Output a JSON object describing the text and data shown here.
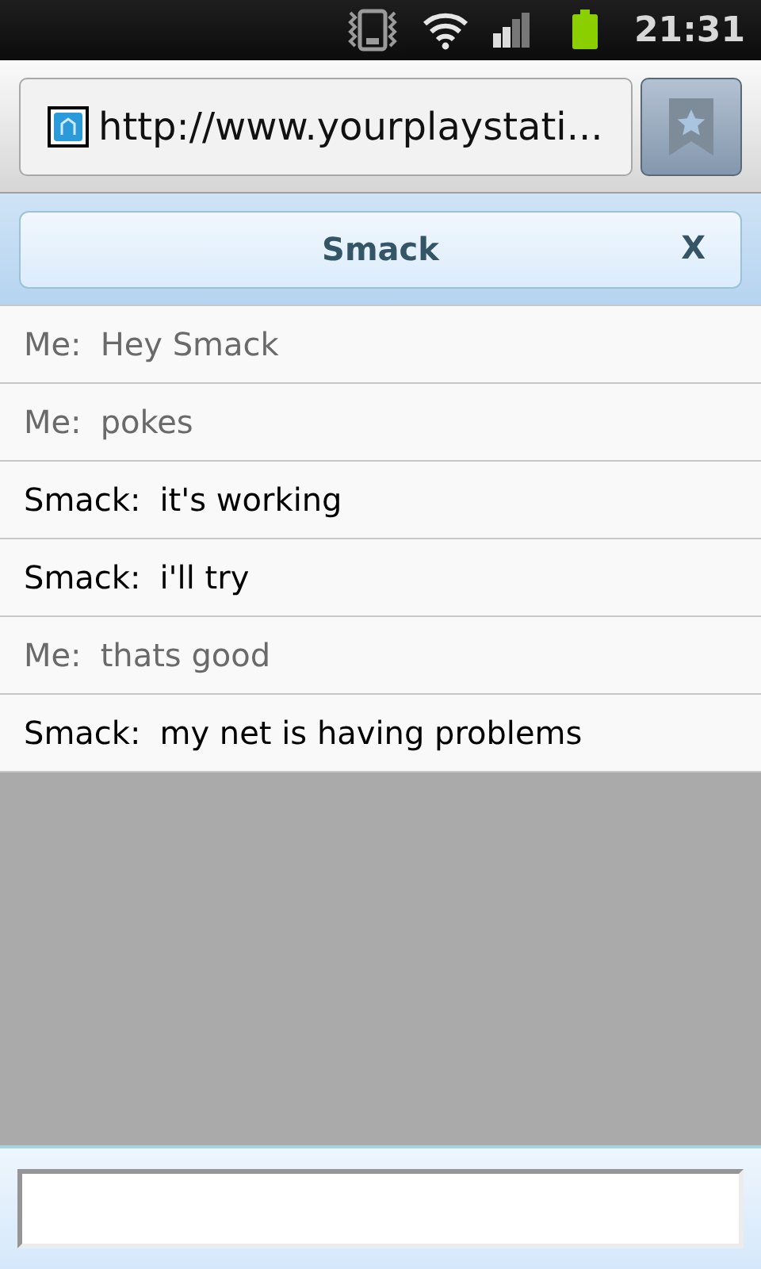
{
  "status_bar": {
    "time": "21:31"
  },
  "address_bar": {
    "url": "http://www.yourplaystati..."
  },
  "chat_header": {
    "title": "Smack",
    "close": "X"
  },
  "messages": [
    {
      "kind": "self",
      "sender": "Me:",
      "text": "Hey Smack"
    },
    {
      "kind": "self",
      "sender": "Me:",
      "text": "pokes"
    },
    {
      "kind": "other",
      "sender": "Smack:",
      "text": "it's working"
    },
    {
      "kind": "other",
      "sender": "Smack:",
      "text": "i'll try"
    },
    {
      "kind": "self",
      "sender": "Me:",
      "text": "thats good"
    },
    {
      "kind": "other",
      "sender": "Smack:",
      "text": "my net is having problems"
    }
  ]
}
